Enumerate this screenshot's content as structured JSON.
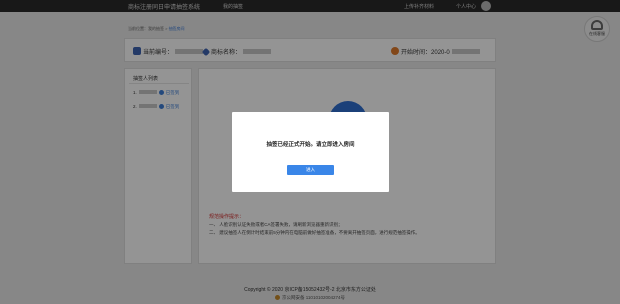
{
  "header": {
    "title": "商标注册同日申请抽签系统",
    "nav_home": "我的抽签",
    "upload": "上传补齐材料",
    "user": "个人中心"
  },
  "chat": {
    "label": "在线客服"
  },
  "breadcrumb": {
    "prefix": "当前位置：",
    "link": "我的抽签",
    "sep": " > ",
    "current": "抽签房间"
  },
  "info": {
    "applicant_label": "当前编号：",
    "trademark_label": "商标名称：",
    "start_label": "开始时间：",
    "start_value": "2020-0"
  },
  "sidebar": {
    "title": "抽签人列表",
    "items": [
      {
        "index": "1.",
        "status": "已签到"
      },
      {
        "index": "2.",
        "status": "已签到"
      }
    ]
  },
  "notice": {
    "title": "规范操作提示：",
    "lines": [
      "一、 人脸识别认证失败或者CA签署失败，请刷新浏览器重新识别；",
      "二、 建议抽签人在倒计时结束前5分钟内在电脑前做好抽签准备，不要离开抽签页面，进行规范抽签操作。"
    ]
  },
  "footer": {
    "copyright": "Copyright © 2020 京ICP备15052432号-2 北京市东方公证处",
    "police": "京公网安备 11010102004274号"
  },
  "modal": {
    "message": "抽签已经正式开始。请立即进入房间",
    "enter": "进入"
  }
}
